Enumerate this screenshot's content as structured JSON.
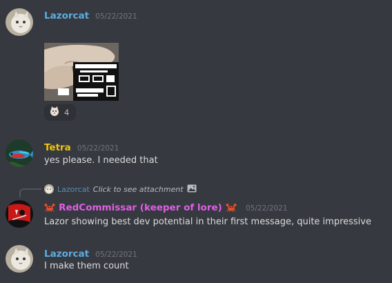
{
  "colors": {
    "background": "#36393f",
    "lazorcat_name": "#5dade2",
    "tetra_name": "#f1c40f",
    "redcommissar_name": "#e05ee6",
    "timestamp": "#72767d",
    "message_text": "#dcddde"
  },
  "messages": [
    {
      "author": "Lazorcat",
      "timestamp": "05/22/2021",
      "avatar_icon": "cat-avatar-icon",
      "attachment": "meme-image",
      "reaction": {
        "icon": "cat-face-emoji-icon",
        "count": "4"
      }
    },
    {
      "author": "Tetra",
      "timestamp": "05/22/2021",
      "avatar_icon": "fish-avatar-icon",
      "text": "yes please. I needed that"
    },
    {
      "author": "RedCommissar (keeper of lore)",
      "timestamp": "05/22/2021",
      "avatar_icon": "red-flag-avatar-icon",
      "name_emoji": "crab-emoji-icon",
      "reply_to": {
        "author": "Lazorcat",
        "text": "Click to see attachment",
        "icon": "image-icon"
      },
      "text": "Lazor showing best dev potential in their first message, quite impressive"
    },
    {
      "author": "Lazorcat",
      "timestamp": "05/22/2021",
      "avatar_icon": "cat-avatar-icon",
      "text": "I make them count"
    }
  ]
}
